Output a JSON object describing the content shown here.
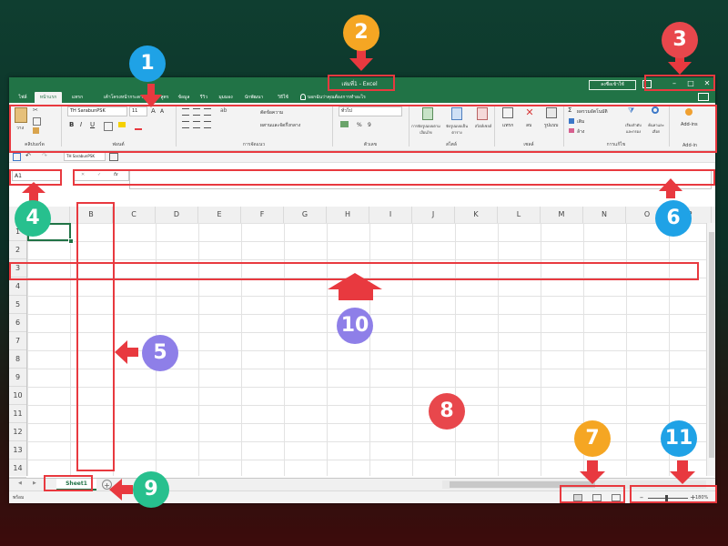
{
  "app": {
    "title": "เล่มที่1 - Excel",
    "signin_label": "ลงชื่อเข้าใช้",
    "window_buttons": [
      "–",
      "□",
      "✕"
    ]
  },
  "menu": {
    "tabs": [
      "ไฟล์",
      "หน้าแรก",
      "แทรก",
      "เค้าโครงหน้ากระดาษ",
      "สูตร",
      "ข้อมูล",
      "รีวิว",
      "มุมมอง",
      "นักพัฒนา",
      "วิธีใช้"
    ],
    "active_tab": "หน้าแรก",
    "tell_me": "บอกฉันว่าคุณต้องการทำอะไร"
  },
  "ribbon": {
    "clipboard": {
      "paste_label": "วาง",
      "group_label": "คลิปบอร์ด"
    },
    "font": {
      "font_name": "TH SarabunPSK",
      "font_size": "11",
      "bold": "B",
      "italic": "I",
      "underline": "U",
      "group_label": "ฟอนต์"
    },
    "alignment": {
      "wrap_text": "ตัดข้อความ",
      "merge_center": "ผสานและจัดกึ่งกลาง",
      "group_label": "การจัดแนว"
    },
    "number": {
      "format": "ทั่วไป",
      "percent": "%",
      "comma": "9",
      "group_label": "ตัวเลข"
    },
    "styles": {
      "conditional": "การจัดรูปแบบตามเงื่อนไข",
      "format_table": "จัดรูปแบบเป็นตาราง",
      "cell_styles": "สไตล์เซลล์",
      "group_label": "สไตล์"
    },
    "cells": {
      "insert": "แทรก",
      "delete": "ลบ",
      "format": "รูปแบบ",
      "group_label": "เซลล์"
    },
    "editing": {
      "autosum": "ผลรวมอัตโนมัติ",
      "fill": "เติม",
      "clear": "ล้าง",
      "sort_filter": "เรียงลำดับและกรอง",
      "find_select": "ค้นหาและเลือก",
      "group_label": "การแก้ไข"
    },
    "addins": {
      "label": "Add-ins",
      "group_label": "Add-in"
    }
  },
  "qat": {
    "font_name": "TH SarabunPSK"
  },
  "formula_bar": {
    "name_box": "A1",
    "fx": "fx",
    "value": ""
  },
  "columns": [
    "A",
    "B",
    "C",
    "D",
    "E",
    "F",
    "G",
    "H",
    "I",
    "J",
    "K",
    "L",
    "M",
    "N",
    "O",
    "P"
  ],
  "rows": [
    "1",
    "2",
    "3",
    "4",
    "5",
    "6",
    "7",
    "8",
    "9",
    "10",
    "11",
    "12",
    "13",
    "14"
  ],
  "sheet": {
    "tab_name": "Sheet1",
    "add_label": "+"
  },
  "status": {
    "mode": "พร้อม",
    "zoom": "180%",
    "zoom_minus": "–",
    "zoom_plus": "+"
  },
  "annotations": {
    "numbers": [
      "1",
      "2",
      "3",
      "4",
      "5",
      "6",
      "7",
      "8",
      "9",
      "10",
      "11"
    ],
    "colors": {
      "1": "#1fa2e6",
      "2": "#f5a623",
      "3": "#e8474c",
      "4": "#27c08e",
      "5": "#8e7fe8",
      "6": "#1fa2e6",
      "7": "#f5a623",
      "8": "#e8474c",
      "9": "#27c08e",
      "10": "#8e7fe8",
      "11": "#1fa2e6"
    }
  },
  "colors": {
    "excel_green": "#217346",
    "annotation_red": "#e8393f"
  }
}
